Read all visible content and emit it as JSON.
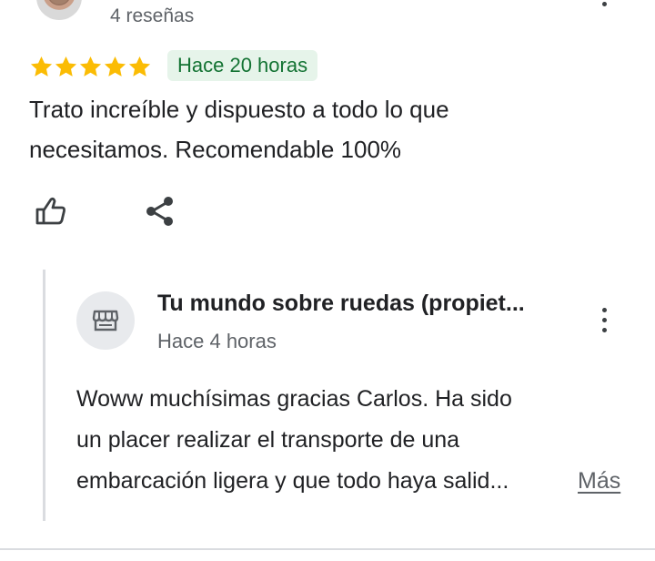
{
  "review": {
    "reviewer_review_count": "4 reseñas",
    "rating": 5,
    "rating_max": 5,
    "time_badge": "Hace 20 horas",
    "text": "Trato increíble y dispuesto a todo lo que necesitamos. Recomendable 100%",
    "accent_color": "#fbbc04",
    "badge_color": "#137333",
    "actions": {
      "like_icon": "thumb-up-icon",
      "share_icon": "share-icon"
    }
  },
  "owner_reply": {
    "name": "Tu mundo sobre ruedas (propiet...",
    "time": "Hace 4 horas",
    "avatar_icon": "storefront-icon",
    "lines": [
      "Woww muchísimas gracias Carlos. Ha sido",
      "un placer realizar el transporte de una",
      "embarcación ligera y que todo haya salid..."
    ],
    "more_label": "Más"
  }
}
